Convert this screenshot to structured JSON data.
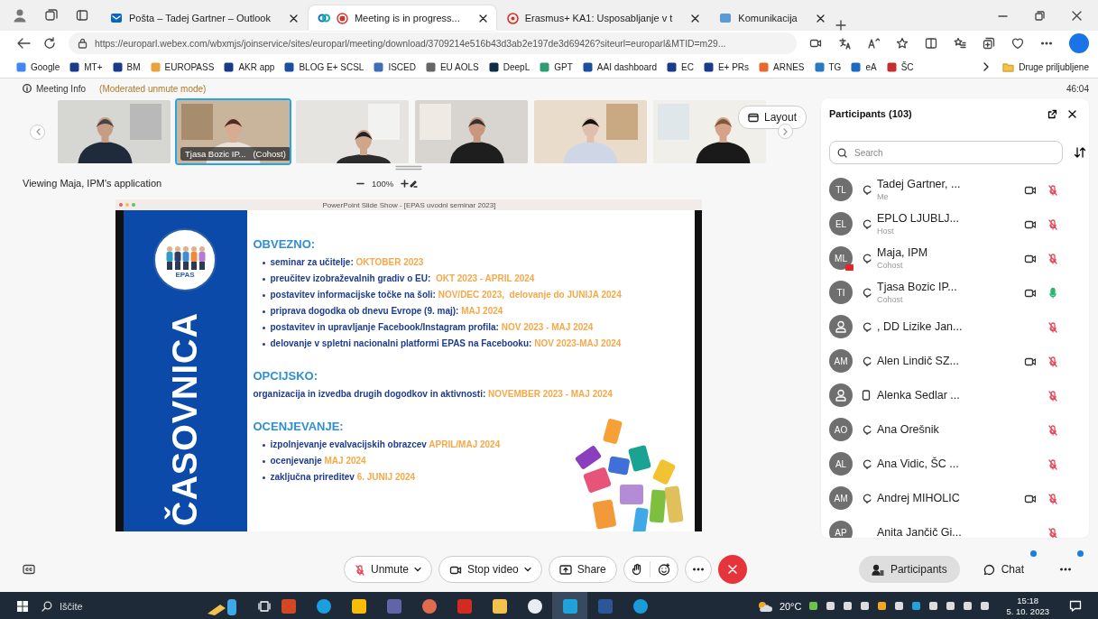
{
  "browser": {
    "tabs": [
      {
        "title": "Pošta – Tadej Gartner – Outlook",
        "selected": false
      },
      {
        "title": "Meeting is in progress...",
        "selected": true,
        "recording": true
      },
      {
        "title": "Erasmus+ KA1: Usposabljanje v t",
        "selected": false
      },
      {
        "title": "Komunikacija",
        "selected": false
      }
    ],
    "url": "https://europarl.webex.com/wbxmjs/joinservice/sites/europarl/meeting/download/3709214e516b43d3ab2e197de3d69426?siteurl=europarl&MTID=m29...",
    "bookmarks": [
      "Google",
      "MT+",
      "BM",
      "EUROPASS",
      "AKR app",
      "BLOG E+ SCSL",
      "ISCED",
      "EU AOLS",
      "DeepL",
      "GPT",
      "AAI dashboard",
      "EC",
      "E+ PRs",
      "ARNES",
      "TG",
      "eA",
      "ŠC"
    ],
    "other_bookmarks": "Druge priljubljene"
  },
  "meeting": {
    "info": "Meeting Info",
    "mode": "(Moderated unmute mode)",
    "timer": "46:04",
    "thumbnails": [
      {
        "selected": false
      },
      {
        "selected": true,
        "name": "Tjasa Bozic IP...",
        "role": "(Cohost)"
      },
      {
        "selected": false
      },
      {
        "selected": false
      },
      {
        "selected": false
      },
      {
        "selected": false
      }
    ],
    "layout_button": "Layout",
    "viewing": "Viewing Maja, IPM's application",
    "zoom": "100%"
  },
  "slide": {
    "window_title": "PowerPoint Slide Show - [EPAS uvodni seminar 2023]",
    "side_title": "ČASOVNICA",
    "logo_text": "EPAS",
    "sections": [
      {
        "heading": "OBVEZNO:",
        "bulleted": true,
        "items": [
          {
            "text": "seminar za učitelje: ",
            "date": "OKTOBER 2023"
          },
          {
            "text": "preučitev izobraževalnih gradiv o EU:  ",
            "date": "OKT 2023 - APRIL 2024"
          },
          {
            "text": "postavitev informacijske točke na šoli: ",
            "date": "NOV/DEC 2023,  delovanje do JUNIJA 2024"
          },
          {
            "text": "priprava dogodka ob dnevu Evrope (9. maj): ",
            "date": "MAJ 2024"
          },
          {
            "text": "postavitev in upravljanje Facebook/Instagram profila: ",
            "date": "NOV 2023 - MAJ 2024"
          },
          {
            "text": "delovanje v spletni nacionalni platformi EPAS na Facebooku: ",
            "date": "NOV 2023-MAJ 2024"
          }
        ]
      },
      {
        "heading": "OPCIJSKO:",
        "bulleted": false,
        "items": [
          {
            "text": "organizacija in izvedba drugih dogodkov in aktivnosti: ",
            "date": "NOVEMBER 2023 - MAJ 2024"
          }
        ]
      },
      {
        "heading": "OCENJEVANJE:",
        "bulleted": true,
        "items": [
          {
            "text": "izpolnjevanje evalvacijskih obrazcev ",
            "date": "APRIL/MAJ 2024"
          },
          {
            "text": "ocenjevanje ",
            "date": "MAJ 2024"
          },
          {
            "text": "zaključna prireditev ",
            "date": "6. JUNIJ 2024"
          }
        ]
      }
    ]
  },
  "participants": {
    "title": "Participants (103)",
    "search_placeholder": "Search",
    "list": [
      {
        "initials": "TL",
        "name": "Tadej Gartner, ...",
        "role": "Me",
        "kind": "computer",
        "video": true,
        "muted": true,
        "sharing": false
      },
      {
        "initials": "EL",
        "name": "EPLO LJUBLJ...",
        "role": "Host",
        "kind": "computer",
        "video": true,
        "muted": true,
        "sharing": false
      },
      {
        "initials": "ML",
        "name": "Maja, IPM",
        "role": "Cohost",
        "kind": "computer",
        "video": true,
        "muted": true,
        "sharing": true
      },
      {
        "initials": "TI",
        "name": "Tjasa Bozic IP...",
        "role": "Cohost",
        "kind": "computer",
        "video": true,
        "muted": false,
        "sharing": false
      },
      {
        "name": ", DD Lizike Jan...",
        "kind": "computer",
        "video": false,
        "muted": true,
        "sharing": false
      },
      {
        "initials": "AM",
        "name": "Alen Lindič SZ...",
        "kind": "computer",
        "video": true,
        "muted": true,
        "sharing": false
      },
      {
        "name": "Alenka Sedlar ...",
        "kind": "phone",
        "video": false,
        "muted": true,
        "sharing": false
      },
      {
        "initials": "AO",
        "name": "Ana Orešnik",
        "kind": "computer",
        "video": false,
        "muted": true,
        "sharing": false
      },
      {
        "initials": "AL",
        "name": "Ana Vidic, ŠC ...",
        "kind": "computer",
        "video": false,
        "muted": true,
        "sharing": false
      },
      {
        "initials": "AM",
        "name": "Andrej MIHOLIC",
        "kind": "computer",
        "video": true,
        "muted": true,
        "sharing": false
      },
      {
        "initials": "AP",
        "name": "Anita Jančič Gi...",
        "kind": "none",
        "video": false,
        "muted": true,
        "sharing": false
      }
    ]
  },
  "controls": {
    "main": [
      {
        "kind": "mic",
        "label": "Unmute",
        "muted": true,
        "dropdown": true
      },
      {
        "kind": "video",
        "label": "Stop video",
        "dropdown": true
      },
      {
        "kind": "share",
        "label": "Share"
      },
      {
        "kind": "reactions"
      },
      {
        "kind": "more"
      },
      {
        "kind": "leave"
      }
    ],
    "side": [
      {
        "kind": "participants",
        "label": "Participants",
        "selected": true,
        "unread": false
      },
      {
        "kind": "chat",
        "label": "Chat",
        "selected": false,
        "unread": true
      },
      {
        "kind": "more",
        "selected": false,
        "unread": true
      }
    ]
  },
  "taskbar": {
    "search_placeholder": "Iščite",
    "apps": [
      {
        "selected": false
      },
      {
        "selected": false
      },
      {
        "selected": false
      },
      {
        "selected": false
      },
      {
        "selected": false
      },
      {
        "selected": false
      },
      {
        "selected": false
      },
      {
        "selected": false
      },
      {
        "selected": true
      },
      {
        "selected": false
      },
      {
        "selected": false
      }
    ],
    "temperature": "20°C",
    "time": "15:18",
    "date": "5. 10. 2023"
  }
}
